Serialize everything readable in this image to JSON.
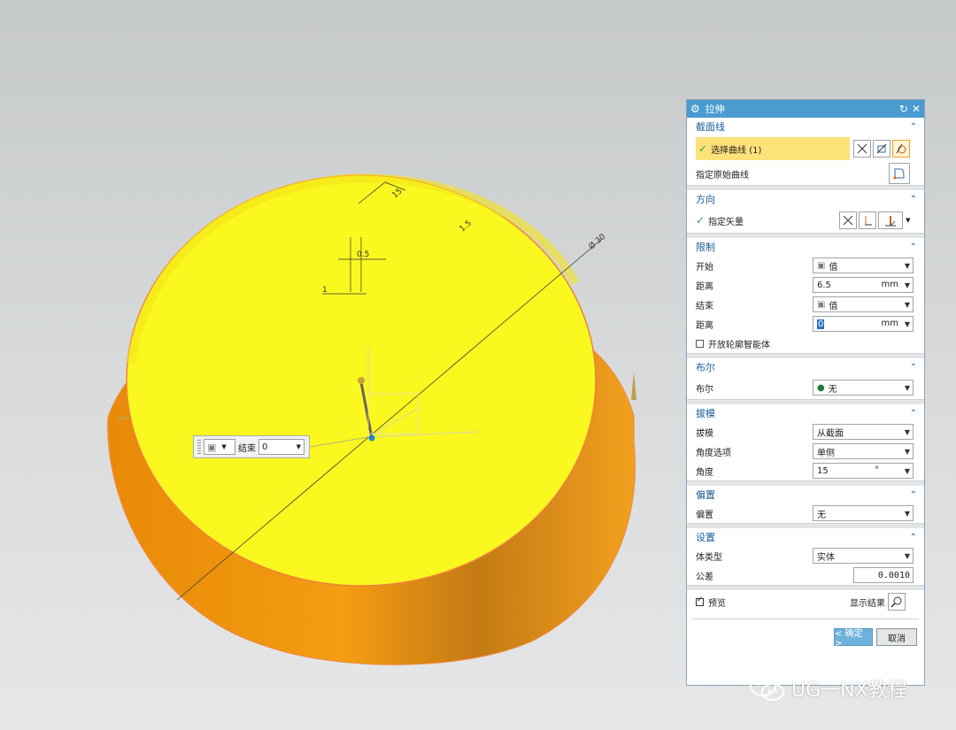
{
  "model": {
    "dim_angle": "15",
    "dim_small": "1.5",
    "dim_half": "0.5",
    "dim_one": "1",
    "dim_diameter": "Ø 30"
  },
  "float_bar": {
    "end_label": "结束",
    "end_value": "0"
  },
  "dialog": {
    "title": "拉伸",
    "sections": {
      "section": {
        "header": "截面线",
        "select_curve": "选择曲线 (1)",
        "specify_origin": "指定原始曲线"
      },
      "direction": {
        "header": "方向",
        "specify_vector": "指定矢量"
      },
      "limits": {
        "header": "限制",
        "start_label": "开始",
        "start_value": "值",
        "dist1_label": "距离",
        "dist1_value": "6.5",
        "dist1_unit": "mm",
        "end_label": "结束",
        "end_value": "值",
        "dist2_label": "距离",
        "dist2_value": "0",
        "dist2_unit": "mm",
        "open_profile": "开放轮廓智能体"
      },
      "boolean": {
        "header": "布尔",
        "label": "布尔",
        "value": "无"
      },
      "draft": {
        "header": "拔模",
        "draft_label": "拔模",
        "draft_value": "从截面",
        "angle_option_label": "角度选项",
        "angle_option_value": "单侧",
        "angle_label": "角度",
        "angle_value": "15",
        "angle_unit": "°"
      },
      "offset": {
        "header": "偏置",
        "label": "偏置",
        "value": "无"
      },
      "settings": {
        "header": "设置",
        "body_type_label": "体类型",
        "body_type_value": "实体",
        "tolerance_label": "公差",
        "tolerance_value": "0.0010"
      }
    },
    "preview_label": "预览",
    "show_result_label": "显示结果",
    "ok_label": "< 确定 >",
    "cancel_label": "取消"
  },
  "watermark": "UG一NX教程",
  "colors": {
    "title_bar": "#4a9bd0",
    "section_header": "#1b5b96",
    "highlight_row": "#fde27a",
    "top_face": "#fbf81f",
    "side_face": "#f39a10",
    "ok_button": "#6eb2dc"
  }
}
